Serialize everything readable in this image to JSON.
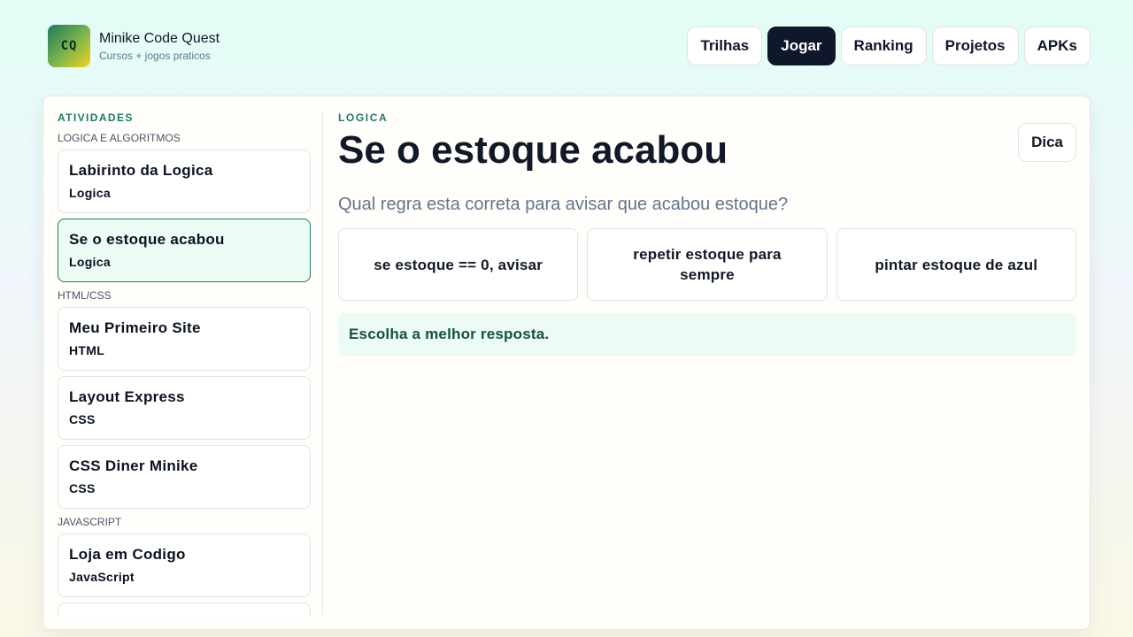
{
  "brand": {
    "logo_text": "CQ",
    "title": "Minike Code Quest",
    "subtitle": "Cursos + jogos praticos"
  },
  "nav": {
    "items": [
      {
        "label": "Trilhas",
        "active": false
      },
      {
        "label": "Jogar",
        "active": true
      },
      {
        "label": "Ranking",
        "active": false
      },
      {
        "label": "Projetos",
        "active": false
      },
      {
        "label": "APKs",
        "active": false
      }
    ]
  },
  "sidebar": {
    "title": "ATIVIDADES",
    "groups": [
      {
        "label": "LOGICA E ALGORITMOS",
        "items": [
          {
            "title": "Labirinto da Logica",
            "tag": "Logica"
          },
          {
            "title": "Se o estoque acabou",
            "tag": "Logica",
            "active": true
          }
        ]
      },
      {
        "label": "HTML/CSS",
        "items": [
          {
            "title": "Meu Primeiro Site",
            "tag": "HTML"
          },
          {
            "title": "Layout Express",
            "tag": "CSS"
          },
          {
            "title": "CSS Diner Minike",
            "tag": "CSS"
          }
        ]
      },
      {
        "label": "JAVASCRIPT",
        "items": [
          {
            "title": "Loja em Codigo",
            "tag": "JavaScript"
          }
        ]
      }
    ]
  },
  "activity": {
    "category": "LOGICA",
    "title": "Se o estoque acabou",
    "hint_label": "Dica",
    "question": "Qual regra esta correta para avisar que acabou estoque?",
    "options": [
      "se estoque == 0, avisar",
      "repetir estoque para sempre",
      "pintar estoque de azul"
    ],
    "feedback": "Escolha a melhor resposta."
  },
  "colors": {
    "accent": "#1f7a62",
    "nav_active_bg": "#0f172a",
    "selected_bg": "#ecfbf4"
  }
}
